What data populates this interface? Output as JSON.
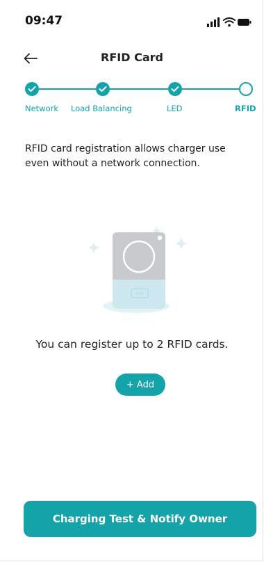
{
  "status_bar": {
    "time": "09:47"
  },
  "header": {
    "title": "RFID Card"
  },
  "stepper": {
    "steps": [
      {
        "label": "Network",
        "state": "done"
      },
      {
        "label": "Load Balancing",
        "state": "done"
      },
      {
        "label": "LED",
        "state": "done"
      },
      {
        "label": "RFID",
        "state": "current"
      }
    ]
  },
  "main": {
    "description": "RFID card registration allows charger use even without a network connection.",
    "info_text": "You can register up to 2 RFID cards.",
    "add_label": "+ Add"
  },
  "footer": {
    "primary_button_label": "Charging Test & Notify Owner"
  },
  "colors": {
    "accent": "#14a3a9",
    "text": "#222222",
    "illustration_light": "#cde9ef"
  },
  "icons": {
    "back": "arrow-left-icon",
    "done": "check-icon",
    "signal": "signal-icon",
    "wifi": "wifi-icon",
    "battery": "battery-icon",
    "illustration": "rfid-card-reader-illustration"
  }
}
